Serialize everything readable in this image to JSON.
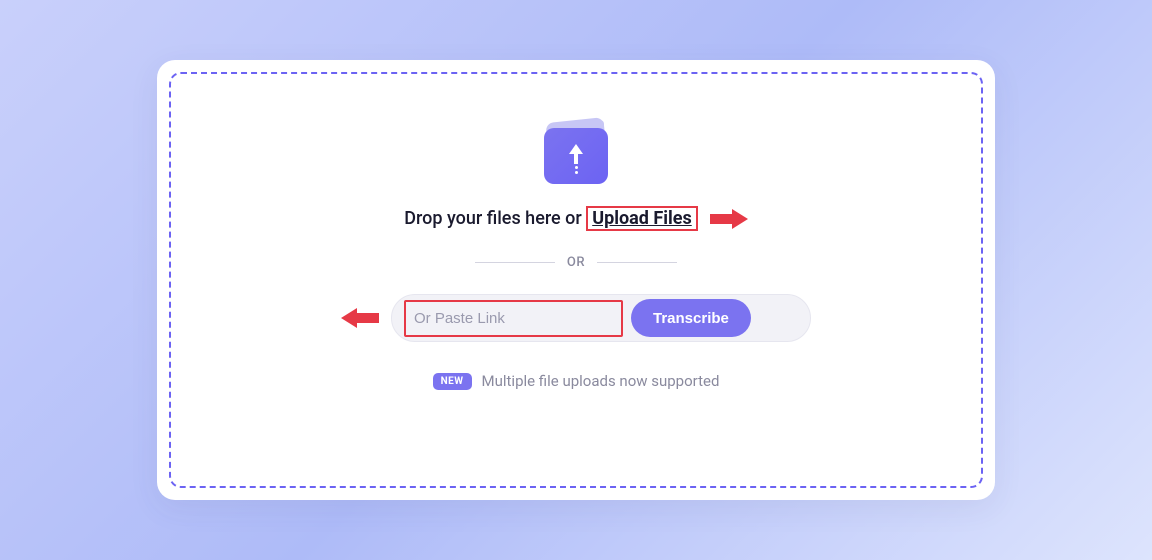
{
  "dropzone": {
    "text_prefix": "Drop your files here or ",
    "upload_link_label": "Upload Files"
  },
  "divider": {
    "label": "OR"
  },
  "input": {
    "placeholder": "Or Paste Link",
    "button_label": "Transcribe"
  },
  "footer": {
    "badge": "NEW",
    "text": "Multiple file uploads now supported"
  },
  "icons": {
    "upload": "upload-folder-icon"
  },
  "colors": {
    "accent": "#7b73f0",
    "annotation": "#e63946"
  }
}
